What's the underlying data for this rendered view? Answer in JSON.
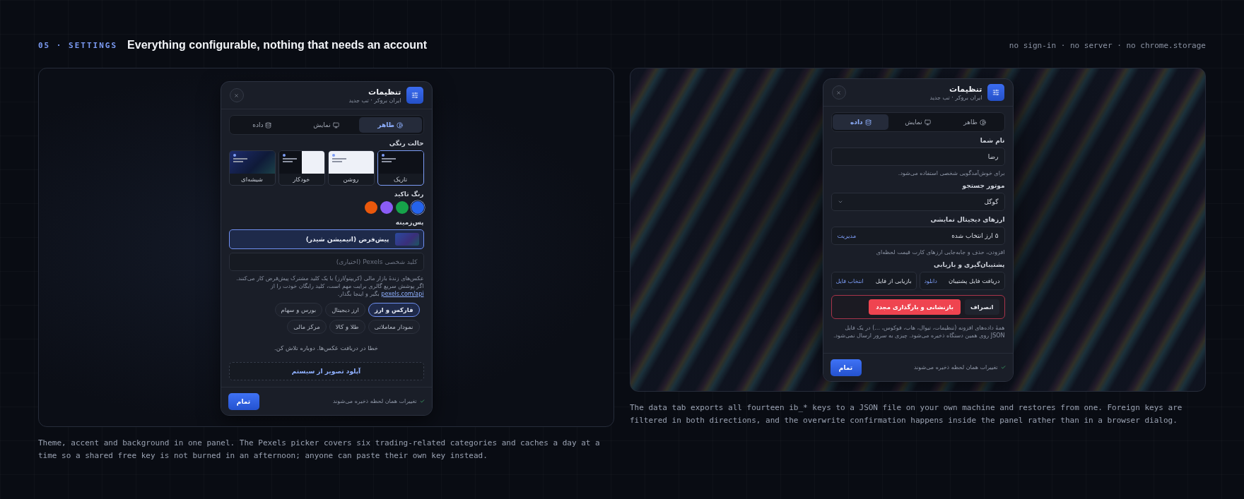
{
  "header": {
    "eyebrow": "05 · SETTINGS",
    "title": "Everything configurable, nothing that needs an account",
    "note": "no sign-in · no server · no chrome.storage"
  },
  "panels": [
    {
      "modal": {
        "title": "تنظیمات",
        "subtitle": "ایران بروکر · تب جدید",
        "tabs": [
          {
            "label": "ظاهر",
            "selected": true
          },
          {
            "label": "نمایش",
            "selected": false
          },
          {
            "label": "داده",
            "selected": false
          }
        ],
        "sections": [
          {
            "kind": "modes",
            "label": "حالت رنگی",
            "options": [
              {
                "label": "تاریک",
                "kind": "dark",
                "selected": true
              },
              {
                "label": "روشن",
                "kind": "light",
                "selected": false
              },
              {
                "label": "خودکار",
                "kind": "auto",
                "selected": false
              },
              {
                "label": "شیشه‌ای",
                "kind": "glass",
                "selected": false
              }
            ]
          },
          {
            "kind": "accents",
            "label": "رنگ تاکید",
            "colors": [
              {
                "color": "#2563eb",
                "selected": true
              },
              {
                "color": "#16a34a",
                "selected": false
              },
              {
                "color": "#8b5cf6",
                "selected": false
              },
              {
                "color": "#ea580c",
                "selected": false
              }
            ]
          },
          {
            "kind": "background",
            "label": "پس‌زمینه",
            "option": "پیش‌فرض (انیمیشن شیدر)",
            "placeholder": "کلید شخصی Pexels (اختیاری)",
            "help_before": "عکس‌های زندهٔ بازار مالی (کریپتو/ارز) با یک کلید مشترک پیش‌فرض کار می‌کنند. اگر پوشش سریع گالری برایت مهم است، کلید رایگان خودت را از",
            "link": "pexels.com/api",
            "help_after": "بگیر و اینجا بگذار."
          },
          {
            "kind": "chips",
            "chips": [
              {
                "label": "فارکس و ارز",
                "selected": true
              },
              {
                "label": "ارز دیجیتال",
                "selected": false
              },
              {
                "label": "بورس و سهام",
                "selected": false
              },
              {
                "label": "نمودار معاملاتی",
                "selected": false
              },
              {
                "label": "طلا و کالا",
                "selected": false
              },
              {
                "label": "مرکز مالی",
                "selected": false
              }
            ]
          },
          {
            "kind": "error",
            "text": "خطا در دریافت عکس‌ها. دوباره تلاش کن."
          },
          {
            "kind": "upload",
            "text": "آپلود تصویر از سیستم"
          }
        ],
        "footer": {
          "status": "تغییرات همان لحظه ذخیره می‌شوند",
          "done": "تمام"
        }
      },
      "caption": "Theme, accent and background in one panel. The Pexels picker covers six trading-related categories and caches a day at a time so a shared free key is not burned in an afternoon; anyone can paste their own key instead."
    },
    {
      "modal": {
        "title": "تنظیمات",
        "subtitle": "ایران بروکر · تب جدید",
        "tabs": [
          {
            "label": "ظاهر",
            "selected": false
          },
          {
            "label": "نمایش",
            "selected": false
          },
          {
            "label": "داده",
            "selected": true
          }
        ],
        "sections": [
          {
            "kind": "text_field",
            "label": "نام شما",
            "value": "رضا",
            "hint": "برای خوش‌آمدگویی شخصی استفاده می‌شود."
          },
          {
            "kind": "select",
            "label": "موتور جستجو",
            "value": "گوگل"
          },
          {
            "kind": "manage",
            "label": "ارزهای دیجیتال نمایشی",
            "value": "۵ ارز انتخاب شده",
            "link": "مدیریت",
            "hint": "افزودن، حذف و جابه‌جایی ارزهای کارت قیمت لحظه‌ای"
          },
          {
            "kind": "backup",
            "label": "پشتیبان‌گیری و بازیابی",
            "cards": [
              {
                "label": "دریافت فایل پشتیبان",
                "action": "دانلود"
              },
              {
                "label": "بازیابی از فایل",
                "action": "انتخاب فایل"
              }
            ]
          },
          {
            "kind": "confirm",
            "cancel": "انصراف",
            "danger": "بازنشانی و بارگذاری مجدد"
          },
          {
            "kind": "note",
            "text": "همهٔ داده‌های افزونه (تنظیمات، تیوال، هاب، فوکوس، ...) در یک فایل JSON روی همین دستگاه ذخیره می‌شود. چیزی به سرور ارسال نمی‌شود."
          }
        ],
        "footer": {
          "status": "تغییرات همان لحظه ذخیره می‌شوند",
          "done": "تمام"
        }
      },
      "caption": "The data tab exports all fourteen ib_* keys to a JSON file on your own machine and restores from one. Foreign keys are filtered in both directions, and the overwrite confirmation happens inside the panel rather than in a browser dialog."
    }
  ]
}
